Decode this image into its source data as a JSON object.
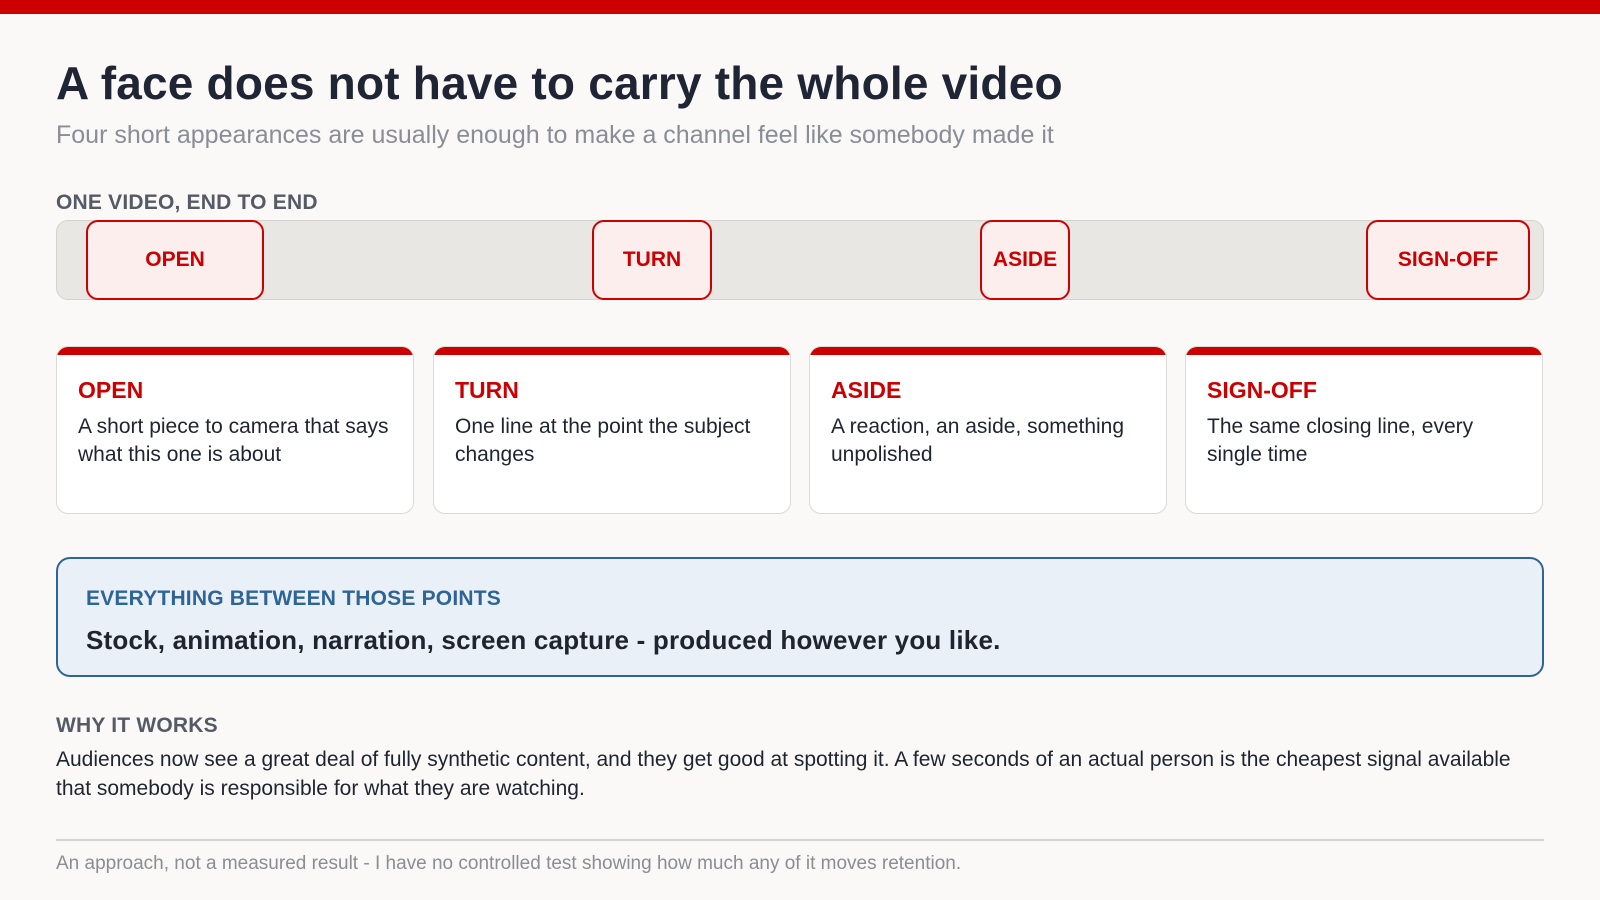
{
  "title": "A face does not have to carry the whole video",
  "subtitle": "Four short appearances are usually enough to make a channel feel like somebody made it",
  "timeline": {
    "label": "ONE VIDEO, END TO END",
    "markers": [
      "OPEN",
      "TURN",
      "ASIDE",
      "SIGN-OFF"
    ]
  },
  "cards": [
    {
      "title": "OPEN",
      "body": "A short piece to camera that says what this one is about"
    },
    {
      "title": "TURN",
      "body": "One line at the point the subject changes"
    },
    {
      "title": "ASIDE",
      "body": "A reaction, an aside, something unpolished"
    },
    {
      "title": "SIGN-OFF",
      "body": "The same closing line, every single time"
    }
  ],
  "callout": {
    "label": "EVERYTHING BETWEEN THOSE POINTS",
    "text": "Stock, animation, narration, screen capture - produced however you like."
  },
  "why": {
    "label": "WHY IT WORKS",
    "text": "Audiences now see a great deal of fully synthetic content, and they get good at spotting it. A few seconds of an actual person is the cheapest signal available that somebody is responsible for what they are watching."
  },
  "footnote": "An approach, not a measured result - I have no controlled test showing how much any of it moves retention.",
  "colors": {
    "accent": "#cc0000",
    "callout": "#2f6496",
    "background": "#faf9f7"
  }
}
